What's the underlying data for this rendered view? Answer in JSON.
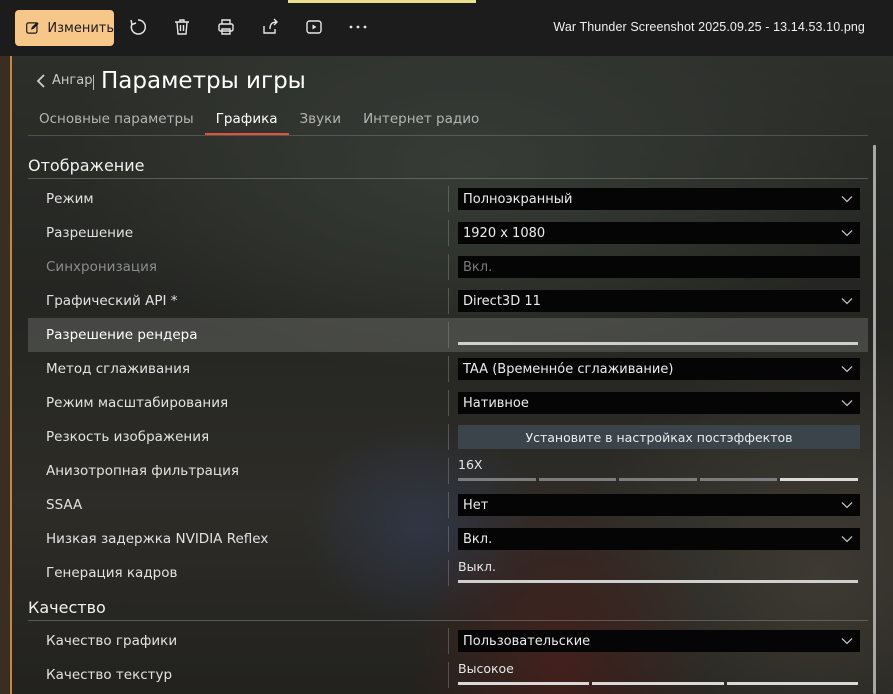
{
  "toolbar": {
    "edit_label": "Изменить",
    "file_title": "War Thunder Screenshot 2025.09.25 - 13.14.53.10.png",
    "icons": [
      "edit-icon",
      "rotate-icon",
      "delete-icon",
      "print-icon",
      "share-icon",
      "slideshow-icon",
      "more-icon"
    ]
  },
  "game": {
    "back_label": "Ангар",
    "title": "Параметры игры",
    "tabs": [
      {
        "label": "Основные параметры",
        "active": false
      },
      {
        "label": "Графика",
        "active": true
      },
      {
        "label": "Звуки",
        "active": false
      },
      {
        "label": "Интернет радио",
        "active": false
      }
    ],
    "accent_color": "#e0533a"
  },
  "sections": {
    "display": {
      "title": "Отображение",
      "rows": [
        {
          "label": "Режим",
          "value": "Полноэкранный",
          "control": "dropdown"
        },
        {
          "label": "Разрешение",
          "value": "1920 x 1080",
          "control": "dropdown"
        },
        {
          "label": "Синхронизация",
          "value": "Вкл.",
          "control": "dropdown",
          "disabled": true
        },
        {
          "label": "Графический API *",
          "value": "Direct3D 11",
          "control": "dropdown"
        },
        {
          "label": "Разрешение рендера",
          "control": "slider",
          "fill": 1.0
        },
        {
          "label": "Метод сглаживания",
          "value": "TAA (Временно́е сглаживание)",
          "control": "dropdown"
        },
        {
          "label": "Режим масштабирования",
          "value": "Нативное",
          "control": "dropdown"
        },
        {
          "label": "Резкость изображения",
          "value": "Установите в настройках постэффектов",
          "control": "button"
        },
        {
          "label": "Анизотропная фильтрация",
          "value": "16X",
          "control": "stepped-slider",
          "level": 5,
          "max": 5
        },
        {
          "label": "SSAA",
          "value": "Нет",
          "control": "dropdown"
        },
        {
          "label": "Низкая задержка NVIDIA Reflex",
          "value": "Вкл.",
          "control": "dropdown"
        },
        {
          "label": "Генерация кадров",
          "value": "Выкл.",
          "control": "slider",
          "fill": 1.0
        }
      ]
    },
    "quality": {
      "title": "Качество",
      "rows": [
        {
          "label": "Качество графики",
          "value": "Пользовательские",
          "control": "dropdown"
        },
        {
          "label": "Качество текстур",
          "value": "Высокое",
          "control": "stepped-slider",
          "level": 3,
          "max": 3
        }
      ]
    }
  }
}
